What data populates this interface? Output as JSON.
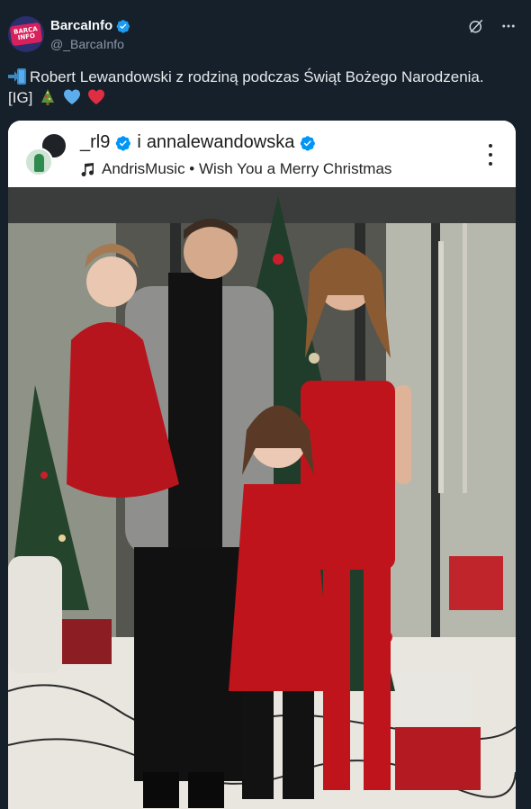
{
  "tweet": {
    "display_name": "BarcaInfo",
    "handle": "@_BarcaInfo",
    "avatar_text": "BARCA INFO",
    "text_line1": "Robert Lewandowski z rodziną podczas Świąt Bożego Narodzenia.",
    "text_line2": "[IG]",
    "icons": [
      "verified-badge-icon",
      "grok-icon",
      "more-icon",
      "arrow-right-emoji",
      "christmas-tree-emoji",
      "blue-heart-emoji",
      "red-heart-emoji"
    ]
  },
  "media": {
    "ig_user1": "_rl9",
    "ig_connector": "i",
    "ig_user2": "annalewandowska",
    "ig_music": "AndrisMusic • Wish You a Merry Christmas",
    "icons": [
      "music-note-icon",
      "verified-badge-icon",
      "more-vertical-icon"
    ]
  },
  "colors": {
    "background": "#15202b",
    "verified_blue": "#1d9bf0",
    "dress_red": "#c0141c",
    "ig_verified": "#0095f6"
  }
}
